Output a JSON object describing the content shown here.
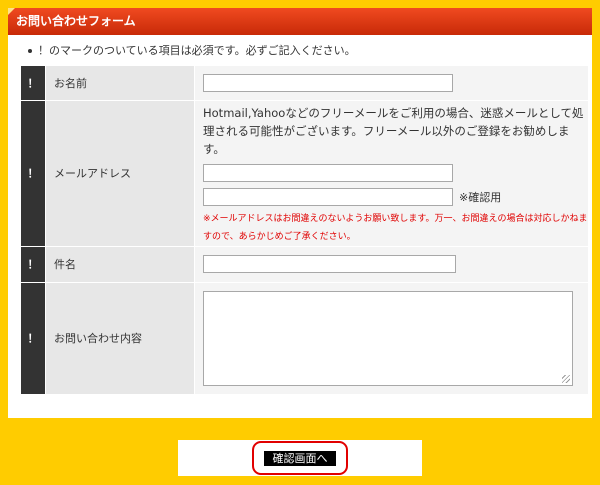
{
  "form": {
    "title": "お問い合わせフォーム",
    "notice": "！のマークのついている項目は必須です。必ずご記入ください。",
    "required_mark": "！",
    "fields": {
      "name": {
        "label": "お名前",
        "value": ""
      },
      "email": {
        "label": "メールアドレス",
        "note": "Hotmail,Yahooなどのフリーメールをご利用の場合、迷惑メールとして処理される可能性がございます。フリーメール以外のご登録をお勧めします。",
        "value": "",
        "confirm_value": "",
        "confirm_label": "※確認用",
        "warning": "※メールアドレスはお間違えのないようお願い致します。万一、お間違えの場合は対応しかねますので、あらかじめご了承ください。"
      },
      "subject": {
        "label": "件名",
        "value": ""
      },
      "message": {
        "label": "お問い合わせ内容",
        "value": ""
      }
    }
  },
  "actions": {
    "confirm_button": "確認画面へ"
  },
  "colors": {
    "page_bg": "#ffcc00",
    "header_red": "#d8320c",
    "required_bg": "#333333",
    "label_bg": "#e7e7e7",
    "warning_red": "#e00000",
    "highlight_outline": "#e10000"
  }
}
